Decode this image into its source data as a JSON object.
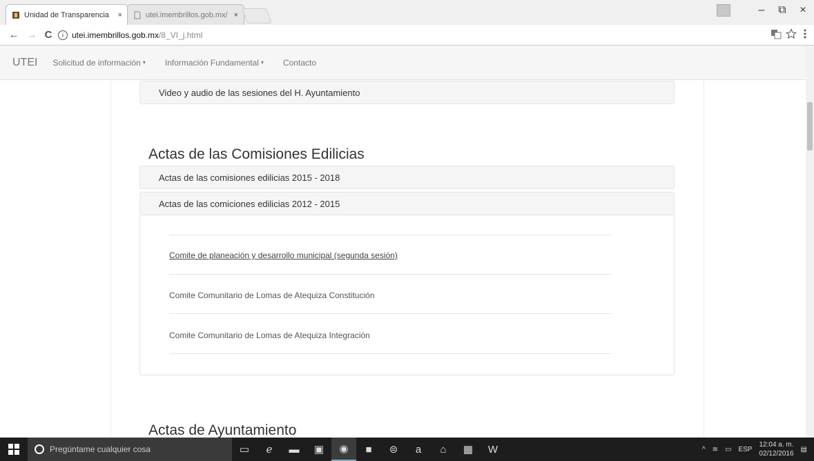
{
  "browser": {
    "tabs": [
      {
        "title": "Unidad de Transparencia",
        "close": "×"
      },
      {
        "title": "utei.imembrillos.gob.mx/",
        "close": "×"
      }
    ],
    "window_controls": {
      "minimize": "–",
      "maximize": "⧉",
      "close": "×"
    },
    "nav": {
      "back": "←",
      "forward": "→",
      "reload": "C"
    },
    "url_host": "utei.imembrillos.gob.mx",
    "url_path": "/8_VI_j.html",
    "info_icon": "i"
  },
  "site_nav": {
    "brand": "UTEI",
    "links": [
      {
        "label": "Solicitud de información",
        "caret": "▾"
      },
      {
        "label": "Información Fundamental",
        "caret": "▾"
      },
      {
        "label": "Contacto",
        "caret": ""
      }
    ]
  },
  "main": {
    "top_panel": "Video y audio de las sesiones del H. Ayuntamiento",
    "section1_title": "Actas de las Comisiones Edilicias",
    "panels": [
      "Actas de las comisiones edilicias 2015 - 2018",
      "Actas de las comiciones edilicias 2012 - 2015"
    ],
    "documents": [
      "Comite de planeación y desarrollo municipal (segunda sesión)",
      "Comite Comunitario de Lomas de Atequiza Constitución",
      "Comite Comunitario de Lomas de Atequiza Integración"
    ],
    "section2_title": "Actas de Ayuntamiento"
  },
  "taskbar": {
    "search_placeholder": "Pregúntame cualquier cosa",
    "language": "ESP",
    "time": "12:04 a. m.",
    "date": "02/12/2016"
  }
}
